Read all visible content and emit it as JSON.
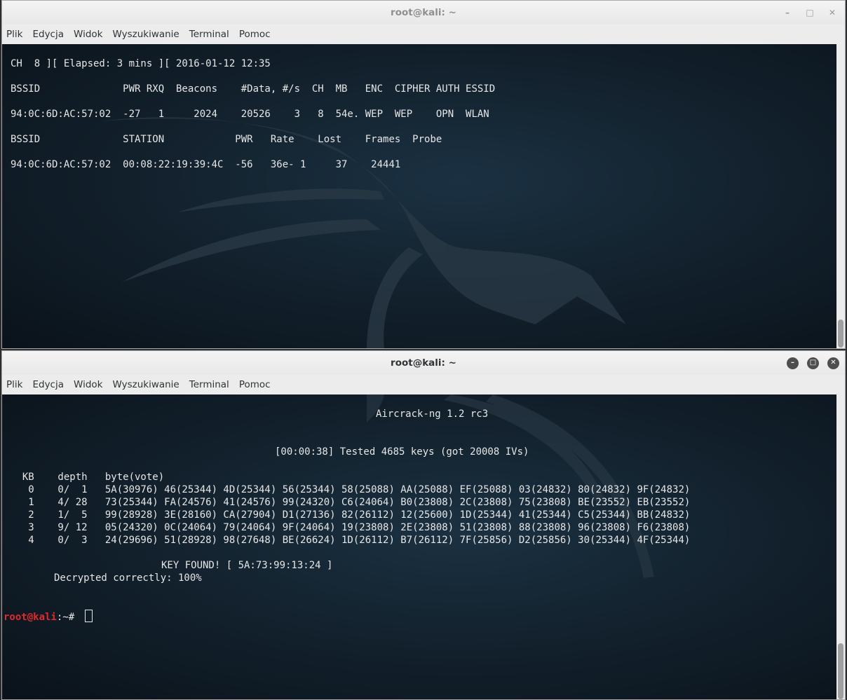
{
  "window1": {
    "title": "root@kali: ~",
    "controls": [
      "–",
      "□",
      "✕"
    ],
    "menu": [
      "Plik",
      "Edycja",
      "Widok",
      "Wyszukiwanie",
      "Terminal",
      "Pomoc"
    ],
    "lines": {
      "status": "CH  8 ][ Elapsed: 3 mins ][ 2016-01-12 12:35",
      "ap_header": "BSSID              PWR RXQ  Beacons    #Data, #/s  CH  MB   ENC  CIPHER AUTH ESSID",
      "ap_row": "94:0C:6D:AC:57:02  -27   1     2024    20526    3   8  54e. WEP  WEP    OPN  WLAN",
      "st_header": "BSSID              STATION            PWR   Rate    Lost    Frames  Probe",
      "st_row": "94:0C:6D:AC:57:02  00:08:22:19:39:4C  -56   36e- 1     37    24441"
    }
  },
  "window2": {
    "title": "root@kali: ~",
    "controls": [
      "–",
      "□",
      "✕"
    ],
    "menu": [
      "Plik",
      "Edycja",
      "Widok",
      "Wyszukiwanie",
      "Terminal",
      "Pomoc"
    ],
    "lines": {
      "app": "Aircrack-ng 1.2 rc3",
      "tested": "[00:00:38] Tested 4685 keys (got 20008 IVs)",
      "kb_header": "  KB    depth   byte(vote)",
      "kb_rows": [
        "   0    0/  1   5A(30976) 46(25344) 4D(25344) 56(25344) 58(25088) AA(25088) EF(25088) 03(24832) 80(24832) 9F(24832)",
        "   1    4/ 28   73(25344) FA(24576) 41(24576) 99(24320) C6(24064) B0(23808) 2C(23808) 75(23808) BE(23552) EB(23552)",
        "   2    1/  5   99(28928) 3E(28160) CA(27904) D1(27136) 82(26112) 12(25600) 1D(25344) 41(25344) C5(25344) BB(24832)",
        "   3    9/ 12   05(24320) 0C(24064) 79(24064) 9F(24064) 19(23808) 2E(23808) 51(23808) 88(23808) 96(23808) F6(23808)",
        "   4    0/  3   24(29696) 51(28928) 98(27648) BE(26624) 1D(26112) B7(26112) 7F(25856) D2(25856) 30(25344) 4F(25344)"
      ],
      "key_found": "KEY FOUND! [ 5A:73:99:13:24 ]",
      "decrypted": "Decrypted correctly: 100%",
      "prompt_user": "root@kali",
      "prompt_path": ":~",
      "prompt_symbol": "# "
    }
  }
}
